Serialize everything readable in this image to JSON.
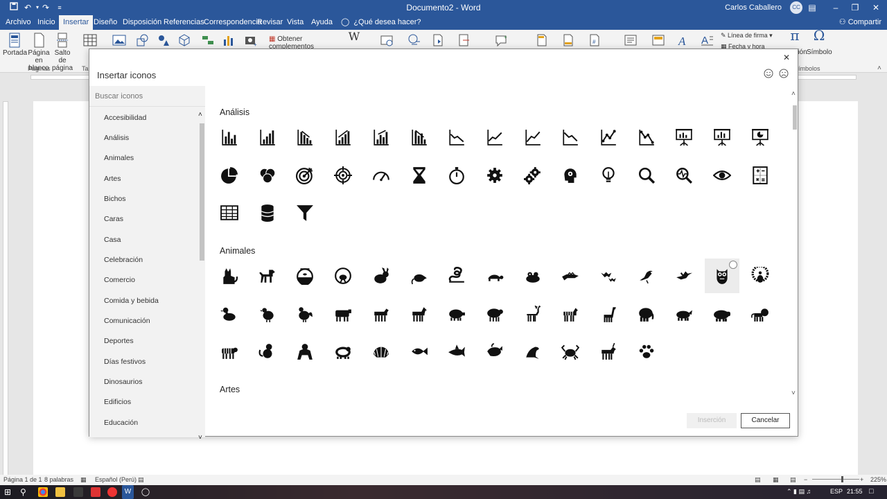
{
  "titlebar": {
    "doc_title": "Documento2 - Word",
    "user_name": "Carlos Caballero",
    "user_initials": "CC"
  },
  "tabs": [
    "Archivo",
    "Inicio",
    "Insertar",
    "Diseño",
    "Disposición",
    "Referencias",
    "Correspondencia",
    "Revisar",
    "Vista",
    "Ayuda"
  ],
  "active_tab": "Insertar",
  "tell_me": "¿Qué desea hacer?",
  "share": "Compartir",
  "ribbon": {
    "portada": "Portada",
    "pagina_blanco": "Página en blanco",
    "salto_pagina": "Salto de página",
    "group_paginas": "Páginas",
    "obtener_complementos": "Obtener complementos",
    "linea_firma": "Línea de firma",
    "fecha_hora": "Fecha y hora",
    "ecuacion": "ión",
    "simbolo": "Símbolo",
    "group_simbolos": "ímbolos",
    "ta": "Ta"
  },
  "dialog": {
    "title": "Insertar iconos",
    "search_placeholder": "Buscar iconos",
    "categories": [
      "Accesibilidad",
      "Análisis",
      "Animales",
      "Artes",
      "Bichos",
      "Caras",
      "Casa",
      "Celebración",
      "Comercio",
      "Comida y bebida",
      "Comunicación",
      "Deportes",
      "Días festivos",
      "Dinosaurios",
      "Edificios",
      "Educación"
    ],
    "sections": [
      {
        "title": "Análisis",
        "icons": [
          "bar-chart",
          "bar-chart-2",
          "bar-chart-down",
          "bar-chart-up",
          "bar-chart-up-2",
          "bar-chart-down-2",
          "line-chart-down",
          "line-chart-up",
          "line-chart-up-2",
          "line-chart-down-2",
          "line-dots-up",
          "line-dots-down",
          "presentation-chart",
          "presentation-chart-2",
          "presentation-pie",
          "pie-chart",
          "venn",
          "target",
          "crosshair",
          "gauge",
          "hourglass",
          "stopwatch",
          "gear",
          "gears",
          "head-gear",
          "lightbulb",
          "magnifier",
          "magnifier-pulse",
          "eye",
          "calculator",
          "table",
          "database",
          "funnel"
        ]
      },
      {
        "title": "Animales",
        "icons": [
          "cat",
          "dog",
          "fishbowl",
          "hamster-wheel",
          "rabbit",
          "rat",
          "snake",
          "turtle",
          "frog",
          "crocodile",
          "bats",
          "bird",
          "hummingbird",
          "owl",
          "peacock",
          "duck",
          "chicken",
          "rooster",
          "cow",
          "goat",
          "horse",
          "pig",
          "sheep",
          "deer",
          "zebra",
          "giraffe",
          "elephant",
          "rhino",
          "hippo",
          "lion",
          "tiger",
          "monkey",
          "gorilla",
          "panda",
          "shell",
          "fish",
          "shark",
          "whale",
          "seal",
          "crab",
          "unicorn",
          "paw"
        ]
      },
      {
        "title": "Artes",
        "icons": []
      }
    ],
    "selected_icon": "owl",
    "insert_label": "Inserción",
    "cancel_label": "Cancelar"
  },
  "status": {
    "page": "Página 1 de 1",
    "words": "8 palabras",
    "language": "Español (Perú)",
    "zoom": "225%"
  },
  "taskbar": {
    "lang": "ESP",
    "time": "21:55"
  },
  "colors": {
    "accent": "#2b579a"
  }
}
